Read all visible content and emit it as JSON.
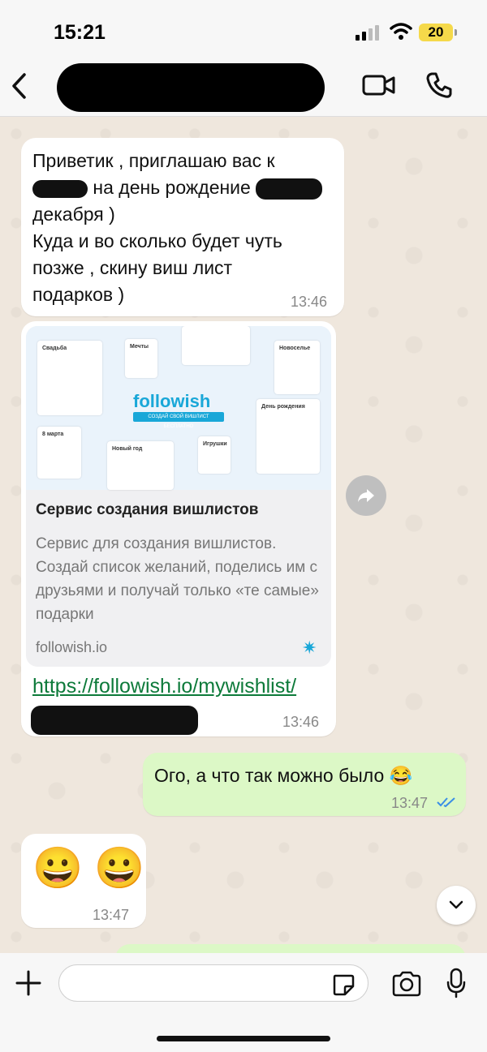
{
  "status_bar": {
    "time": "15:21",
    "battery": "20"
  },
  "header": {
    "contact_name": ""
  },
  "messages": [
    {
      "direction": "in",
      "lines": [
        "Приветик , приглашаю вас к",
        "на день рождение",
        "декабря )",
        "Куда и во сколько будет чуть",
        "позже , скину виш лист",
        "подарков )"
      ],
      "time": "13:46"
    },
    {
      "direction": "in",
      "preview": {
        "logo": "followish",
        "tagline": "СОЗДАЙ СВОЙ ВИШЛИСТ БЕСПЛАТНО",
        "cards": [
          "Свадьба",
          "Мечты",
          "Новоселье",
          "День рождения",
          "8 марта",
          "Новый год",
          "Игрушки"
        ],
        "title": "Сервис создания вишлистов",
        "description": "Сервис для создания вишлистов. Создай список желаний, поделись им с друзьями и получай только «те самые» подарки",
        "domain": "followish.io"
      },
      "link": "https://followish.io/mywishlist/",
      "time": "13:46"
    },
    {
      "direction": "out",
      "text": "Ого, а что так можно было 😂",
      "time": "13:47",
      "status": "read"
    },
    {
      "direction": "in",
      "text": "😀 😀",
      "time": "13:47"
    }
  ],
  "icons": {
    "back": "chevron-left-icon",
    "video": "video-call-icon",
    "phone": "phone-icon",
    "forward": "forward-icon",
    "scroll": "chevron-down-icon",
    "plus": "plus-icon",
    "sticker": "sticker-icon",
    "camera": "camera-icon",
    "mic": "microphone-icon"
  },
  "colors": {
    "outgoing_bubble": "#dcf8c6",
    "incoming_bubble": "#ffffff",
    "link": "#0d7a3a",
    "read_ticks": "#3a8ee6"
  }
}
